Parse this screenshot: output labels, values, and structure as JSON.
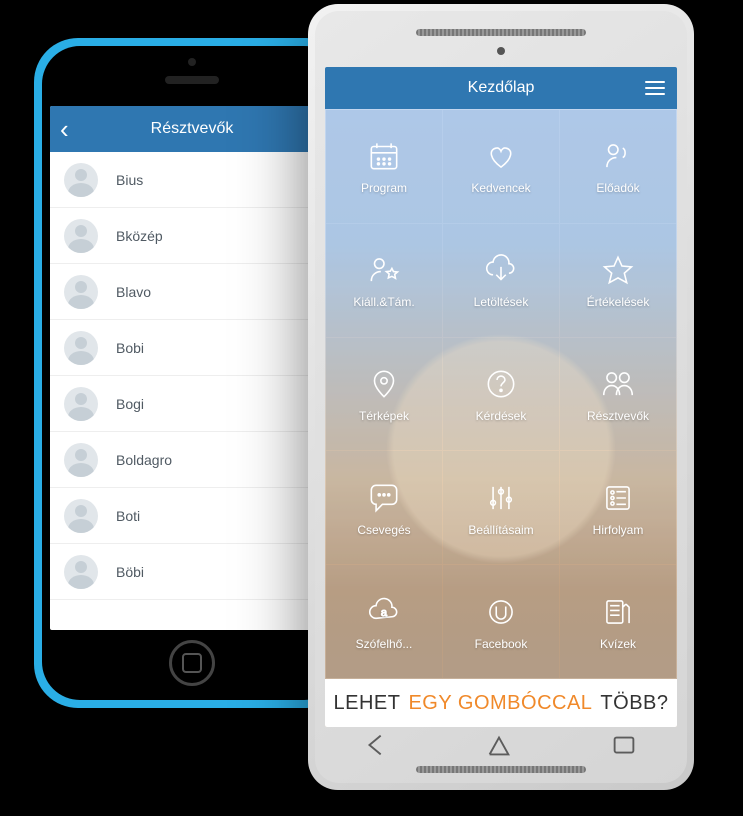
{
  "iphone": {
    "header_title": "Résztvevők",
    "back_symbol": "‹",
    "contacts": [
      "Bius",
      "Bközép",
      "Blavo",
      "Bobi",
      "Bogi",
      "Boldagro",
      "Boti",
      "Böbi"
    ]
  },
  "android": {
    "header_title": "Kezdőlap",
    "banner": {
      "word1": "Lehet",
      "word2": "egy gombóccal",
      "word3": "több?"
    },
    "tiles": [
      {
        "label": "Program",
        "icon": "calendar-icon"
      },
      {
        "label": "Kedvencek",
        "icon": "heart-icon"
      },
      {
        "label": "Előadók",
        "icon": "speaker-icon"
      },
      {
        "label": "Kiáll.&Tám.",
        "icon": "person-star-icon"
      },
      {
        "label": "Letöltések",
        "icon": "download-cloud-icon"
      },
      {
        "label": "Értékelések",
        "icon": "star-icon"
      },
      {
        "label": "Térképek",
        "icon": "map-pin-icon"
      },
      {
        "label": "Kérdések",
        "icon": "question-icon"
      },
      {
        "label": "Résztvevők",
        "icon": "people-icon"
      },
      {
        "label": "Csevegés",
        "icon": "chat-icon"
      },
      {
        "label": "Beállításaim",
        "icon": "sliders-icon"
      },
      {
        "label": "Hirfolyam",
        "icon": "feed-icon"
      },
      {
        "label": "Szófelhő...",
        "icon": "cloud-a-icon"
      },
      {
        "label": "Facebook",
        "icon": "u-circle-icon"
      },
      {
        "label": "Kvízek",
        "icon": "quiz-icon"
      }
    ]
  }
}
